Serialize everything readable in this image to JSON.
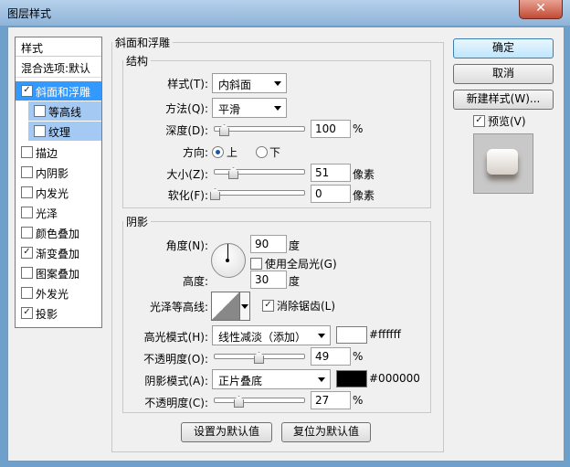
{
  "window": {
    "title": "图层样式",
    "close_glyph": "✕"
  },
  "sidebar": {
    "header": "样式",
    "items": [
      {
        "label": "混合选项:默认",
        "has_checkbox": false,
        "checked": false
      },
      {
        "label": "斜面和浮雕",
        "has_checkbox": true,
        "checked": true
      },
      {
        "label": "等高线",
        "has_checkbox": true,
        "checked": false
      },
      {
        "label": "纹理",
        "has_checkbox": true,
        "checked": false
      },
      {
        "label": "描边",
        "has_checkbox": true,
        "checked": false
      },
      {
        "label": "内阴影",
        "has_checkbox": true,
        "checked": false
      },
      {
        "label": "内发光",
        "has_checkbox": true,
        "checked": false
      },
      {
        "label": "光泽",
        "has_checkbox": true,
        "checked": false
      },
      {
        "label": "颜色叠加",
        "has_checkbox": true,
        "checked": false
      },
      {
        "label": "渐变叠加",
        "has_checkbox": true,
        "checked": true
      },
      {
        "label": "图案叠加",
        "has_checkbox": true,
        "checked": false
      },
      {
        "label": "外发光",
        "has_checkbox": true,
        "checked": false
      },
      {
        "label": "投影",
        "has_checkbox": true,
        "checked": true
      }
    ]
  },
  "bevel": {
    "title": "斜面和浮雕",
    "structure": {
      "title": "结构",
      "style_label": "样式(T):",
      "style_value": "内斜面",
      "technique_label": "方法(Q):",
      "technique_value": "平滑",
      "depth_label": "深度(D):",
      "depth_value": "100",
      "depth_unit": "%",
      "depth_level": 0.1,
      "direction_label": "方向:",
      "dir_up": "上",
      "dir_down": "下",
      "size_label": "大小(Z):",
      "size_value": "51",
      "size_unit": "像素",
      "size_level": 0.2,
      "soften_label": "软化(F):",
      "soften_value": "0",
      "soften_unit": "像素",
      "soften_level": 0
    },
    "shading": {
      "title": "阴影",
      "angle_label": "角度(N):",
      "angle_value": "90",
      "angle_unit": "度",
      "global_light_label": "使用全局光(G)",
      "altitude_label": "高度:",
      "altitude_value": "30",
      "altitude_unit": "度",
      "gloss_label": "光泽等高线:",
      "antialias_label": "消除锯齿(L)",
      "highlight_label": "高光模式(H):",
      "highlight_mode": "线性减淡（添加）",
      "highlight_color": "#ffffff",
      "highlight_color_text": "#ffffff",
      "opacity1_label": "不透明度(O):",
      "opacity1_value": "49",
      "opacity1_unit": "%",
      "opacity1_level": 0.49,
      "shadow_label": "阴影模式(A):",
      "shadow_mode": "正片叠底",
      "shadow_color": "#000000",
      "shadow_color_text": "#000000",
      "opacity2_label": "不透明度(C):",
      "opacity2_value": "27",
      "opacity2_unit": "%",
      "opacity2_level": 0.27
    },
    "make_default": "设置为默认值",
    "reset_default": "复位为默认值"
  },
  "buttons": {
    "ok": "确定",
    "cancel": "取消",
    "new_style": "新建样式(W)...",
    "preview": "预览(V)"
  }
}
